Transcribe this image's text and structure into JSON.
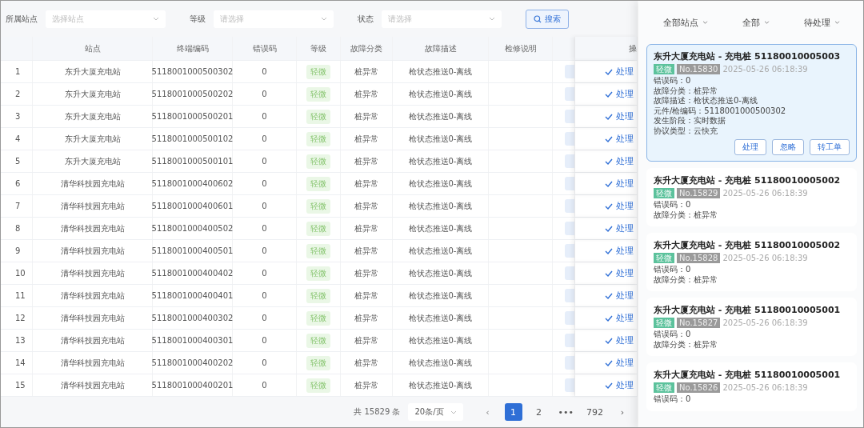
{
  "filters": [
    {
      "label": "所属站点",
      "placeholder": "选择站点"
    },
    {
      "label": "等级",
      "placeholder": "请选择"
    },
    {
      "label": "状态",
      "placeholder": "请选择"
    }
  ],
  "search_button": "搜索",
  "table": {
    "columns": [
      "",
      "站点",
      "终端编码",
      "错误码",
      "等级",
      "故障分类",
      "故障描述",
      "检修说明",
      "",
      "操"
    ],
    "rows": [
      {
        "index": "1",
        "station": "东升大厦充电站",
        "code": "5118001000500302",
        "error": "0",
        "level": "轻微",
        "category": "桩异常",
        "description": "枪状态推送0-离线",
        "action": "处理"
      },
      {
        "index": "2",
        "station": "东升大厦充电站",
        "code": "5118001000500202",
        "error": "0",
        "level": "轻微",
        "category": "桩异常",
        "description": "枪状态推送0-离线",
        "action": "处理"
      },
      {
        "index": "3",
        "station": "东升大厦充电站",
        "code": "5118001000500201",
        "error": "0",
        "level": "轻微",
        "category": "桩异常",
        "description": "枪状态推送0-离线",
        "action": "处理"
      },
      {
        "index": "4",
        "station": "东升大厦充电站",
        "code": "5118001000500102",
        "error": "0",
        "level": "轻微",
        "category": "桩异常",
        "description": "枪状态推送0-离线",
        "action": "处理"
      },
      {
        "index": "5",
        "station": "东升大厦充电站",
        "code": "5118001000500101",
        "error": "0",
        "level": "轻微",
        "category": "桩异常",
        "description": "枪状态推送0-离线",
        "action": "处理"
      },
      {
        "index": "6",
        "station": "清华科技园充电站",
        "code": "5118001000400602",
        "error": "0",
        "level": "轻微",
        "category": "桩异常",
        "description": "枪状态推送0-离线",
        "action": "处理"
      },
      {
        "index": "7",
        "station": "清华科技园充电站",
        "code": "5118001000400601",
        "error": "0",
        "level": "轻微",
        "category": "桩异常",
        "description": "枪状态推送0-离线",
        "action": "处理"
      },
      {
        "index": "8",
        "station": "清华科技园充电站",
        "code": "5118001000400502",
        "error": "0",
        "level": "轻微",
        "category": "桩异常",
        "description": "枪状态推送0-离线",
        "action": "处理"
      },
      {
        "index": "9",
        "station": "清华科技园充电站",
        "code": "5118001000400501",
        "error": "0",
        "level": "轻微",
        "category": "桩异常",
        "description": "枪状态推送0-离线",
        "action": "处理"
      },
      {
        "index": "10",
        "station": "清华科技园充电站",
        "code": "5118001000400402",
        "error": "0",
        "level": "轻微",
        "category": "桩异常",
        "description": "枪状态推送0-离线",
        "action": "处理"
      },
      {
        "index": "11",
        "station": "清华科技园充电站",
        "code": "5118001000400401",
        "error": "0",
        "level": "轻微",
        "category": "桩异常",
        "description": "枪状态推送0-离线",
        "action": "处理"
      },
      {
        "index": "12",
        "station": "清华科技园充电站",
        "code": "5118001000400302",
        "error": "0",
        "level": "轻微",
        "category": "桩异常",
        "description": "枪状态推送0-离线",
        "action": "处理"
      },
      {
        "index": "13",
        "station": "清华科技园充电站",
        "code": "5118001000400301",
        "error": "0",
        "level": "轻微",
        "category": "桩异常",
        "description": "枪状态推送0-离线",
        "action": "处理"
      },
      {
        "index": "14",
        "station": "清华科技园充电站",
        "code": "5118001000400202",
        "error": "0",
        "level": "轻微",
        "category": "桩异常",
        "description": "枪状态推送0-离线",
        "action": "处理"
      },
      {
        "index": "15",
        "station": "清华科技园充电站",
        "code": "5118001000400201",
        "error": "0",
        "level": "轻微",
        "category": "桩异常",
        "description": "枪状态推送0-离线",
        "action": "处理"
      }
    ]
  },
  "pagination": {
    "total": "共 15829 条",
    "page_size": "20条/页",
    "prev": "‹",
    "next": "›",
    "pages": [
      {
        "label": "1",
        "selected": true
      },
      {
        "label": "2",
        "selected": false
      },
      {
        "label": "•••",
        "selected": false
      },
      {
        "label": "792",
        "selected": false
      }
    ]
  },
  "drawer": {
    "dropdowns": [
      "全部站点",
      "全部",
      "待处理"
    ],
    "cards": [
      {
        "title": "东升大厦充电站 - 充电桩 51180010005003",
        "level": "轻微",
        "number": "No.15830",
        "time": "2025-05-26 06:18:39",
        "selected": true,
        "lines": [
          "错误码：0",
          "故障分类：桩异常",
          "故障描述：枪状态推送0-离线",
          "元件/枪编码：5118001000500302",
          "发生阶段：实时数据",
          "协议类型：云快充"
        ],
        "buttons": [
          "处理",
          "忽略",
          "转工单"
        ]
      },
      {
        "title": "东升大厦充电站 - 充电桩 51180010005002",
        "level": "轻微",
        "number": "No.15829",
        "time": "2025-05-26 06:18:39",
        "selected": false,
        "lines": [
          "错误码：0",
          "故障分类：桩异常"
        ]
      },
      {
        "title": "东升大厦充电站 - 充电桩 51180010005002",
        "level": "轻微",
        "number": "No.15828",
        "time": "2025-05-26 06:18:39",
        "selected": false,
        "lines": [
          "错误码：0",
          "故障分类：桩异常"
        ]
      },
      {
        "title": "东升大厦充电站 - 充电桩 51180010005001",
        "level": "轻微",
        "number": "No.15827",
        "time": "2025-05-26 06:18:39",
        "selected": false,
        "lines": [
          "错误码：0",
          "故障分类：桩异常"
        ]
      },
      {
        "title": "东升大厦充电站 - 充电桩 51180010005001",
        "level": "轻微",
        "number": "No.15826",
        "time": "2025-05-26 06:18:39",
        "selected": false,
        "lines": [
          "错误码：0"
        ]
      }
    ]
  }
}
